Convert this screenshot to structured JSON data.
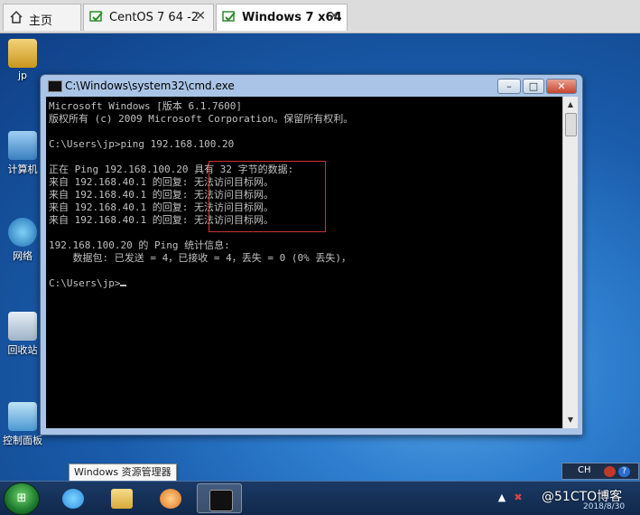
{
  "tabs": [
    {
      "label": "主页",
      "icon": "home-icon",
      "active": false
    },
    {
      "label": "CentOS 7 64 -2",
      "icon": "vm-icon",
      "active": false
    },
    {
      "label": "Windows 7 x64",
      "icon": "vm-icon",
      "active": true
    }
  ],
  "tab_close_glyph": "✕",
  "desktop": {
    "icons": [
      {
        "label": "jp",
        "icon": "user-folder-icon"
      },
      {
        "label": "计算机",
        "icon": "computer-icon"
      },
      {
        "label": "网络",
        "icon": "network-icon"
      },
      {
        "label": "回收站",
        "icon": "recycle-bin-icon"
      },
      {
        "label": "控制面板",
        "icon": "control-panel-icon"
      }
    ]
  },
  "window": {
    "title": "C:\\Windows\\system32\\cmd.exe",
    "min_glyph": "–",
    "max_glyph": "□",
    "close_glyph": "✕"
  },
  "console": {
    "lines": [
      "Microsoft Windows [版本 6.1.7600]",
      "版权所有 (c) 2009 Microsoft Corporation。保留所有权利。",
      "",
      "C:\\Users\\jp>ping 192.168.100.20",
      "",
      "正在 Ping 192.168.100.20 具有 32 字节的数据:",
      "来自 192.168.40.1 的回复: 无法访问目标网。",
      "来自 192.168.40.1 的回复: 无法访问目标网。",
      "来自 192.168.40.1 的回复: 无法访问目标网。",
      "来自 192.168.40.1 的回复: 无法访问目标网。",
      "",
      "192.168.100.20 的 Ping 统计信息:",
      "    数据包: 已发送 = 4，已接收 = 4，丢失 = 0 (0% 丢失)，",
      "",
      "C:\\Users\\jp>"
    ]
  },
  "tooltip": "Windows 资源管理器",
  "taskbar": {
    "items": [
      {
        "name": "ie",
        "icon": "internet-explorer-icon",
        "color": "#2d8fe0"
      },
      {
        "name": "explorer",
        "icon": "folder-icon",
        "color": "#e8c25a"
      },
      {
        "name": "media",
        "icon": "media-player-icon",
        "color": "#f08a24"
      },
      {
        "name": "cmd",
        "icon": "cmd-icon",
        "color": "#111111"
      }
    ]
  },
  "langbar": {
    "lang": "CH"
  },
  "tray": {
    "watermark": "@51CTO博客",
    "date": "2018/8/30"
  }
}
